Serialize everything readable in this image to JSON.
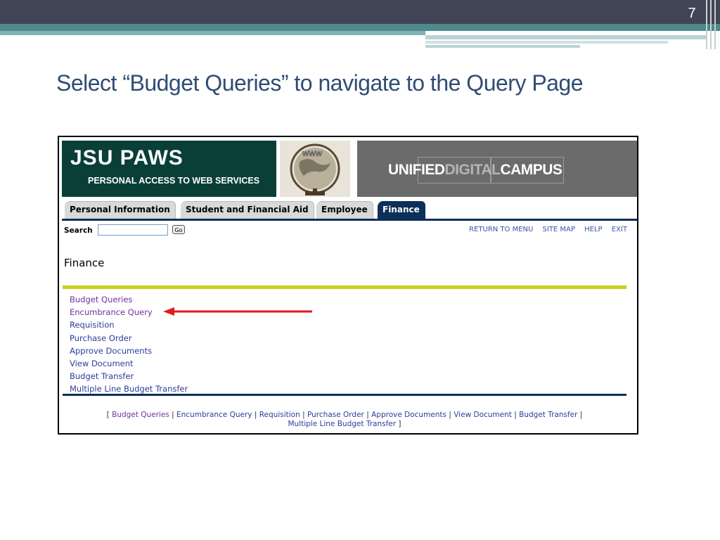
{
  "slide": {
    "number": "7",
    "title": "Select “Budget Queries” to navigate to the Query Page"
  },
  "colors": {
    "slide_header": "#414455",
    "teal": "#4e8a8c",
    "title_text": "#2f4c73",
    "banner_green": "#0a3f38",
    "tab_active": "#0d2f5a",
    "link_visited": "#7030a0",
    "link": "#2c3d9b",
    "yellow_bar": "#c8cf1e",
    "arrow": "#e01b1b"
  },
  "banner": {
    "title": "JSU PAWS",
    "subtitle": "PERSONAL ACCESS TO WEB SERVICES",
    "globe_label": "www",
    "udc": {
      "part1": "UNIFIED",
      "part2": "DIGI",
      "part3": "TAL",
      "part4": "CAMPUS"
    }
  },
  "tabs": [
    {
      "label": "Personal Information",
      "active": false
    },
    {
      "label": "Student and Financial Aid",
      "active": false
    },
    {
      "label": "Employee",
      "active": false
    },
    {
      "label": "Finance",
      "active": true
    }
  ],
  "search": {
    "label": "Search",
    "go_label": "Go",
    "value": ""
  },
  "top_links": [
    "RETURN TO MENU",
    "SITE MAP",
    "HELP",
    "EXIT"
  ],
  "page_heading": "Finance",
  "menu_items": [
    "Budget Queries",
    "Encumbrance Query",
    "Requisition",
    "Purchase Order",
    "Approve Documents",
    "View Document",
    "Budget Transfer",
    "Multiple Line Budget Transfer"
  ],
  "footer": {
    "open_bracket": "[",
    "close_bracket": "]",
    "separator": "|",
    "links": [
      "Budget Queries",
      "Encumbrance Query",
      "Requisition",
      "Purchase Order",
      "Approve Documents",
      "View Document",
      "Budget Transfer",
      "Multiple Line Budget Transfer"
    ]
  }
}
